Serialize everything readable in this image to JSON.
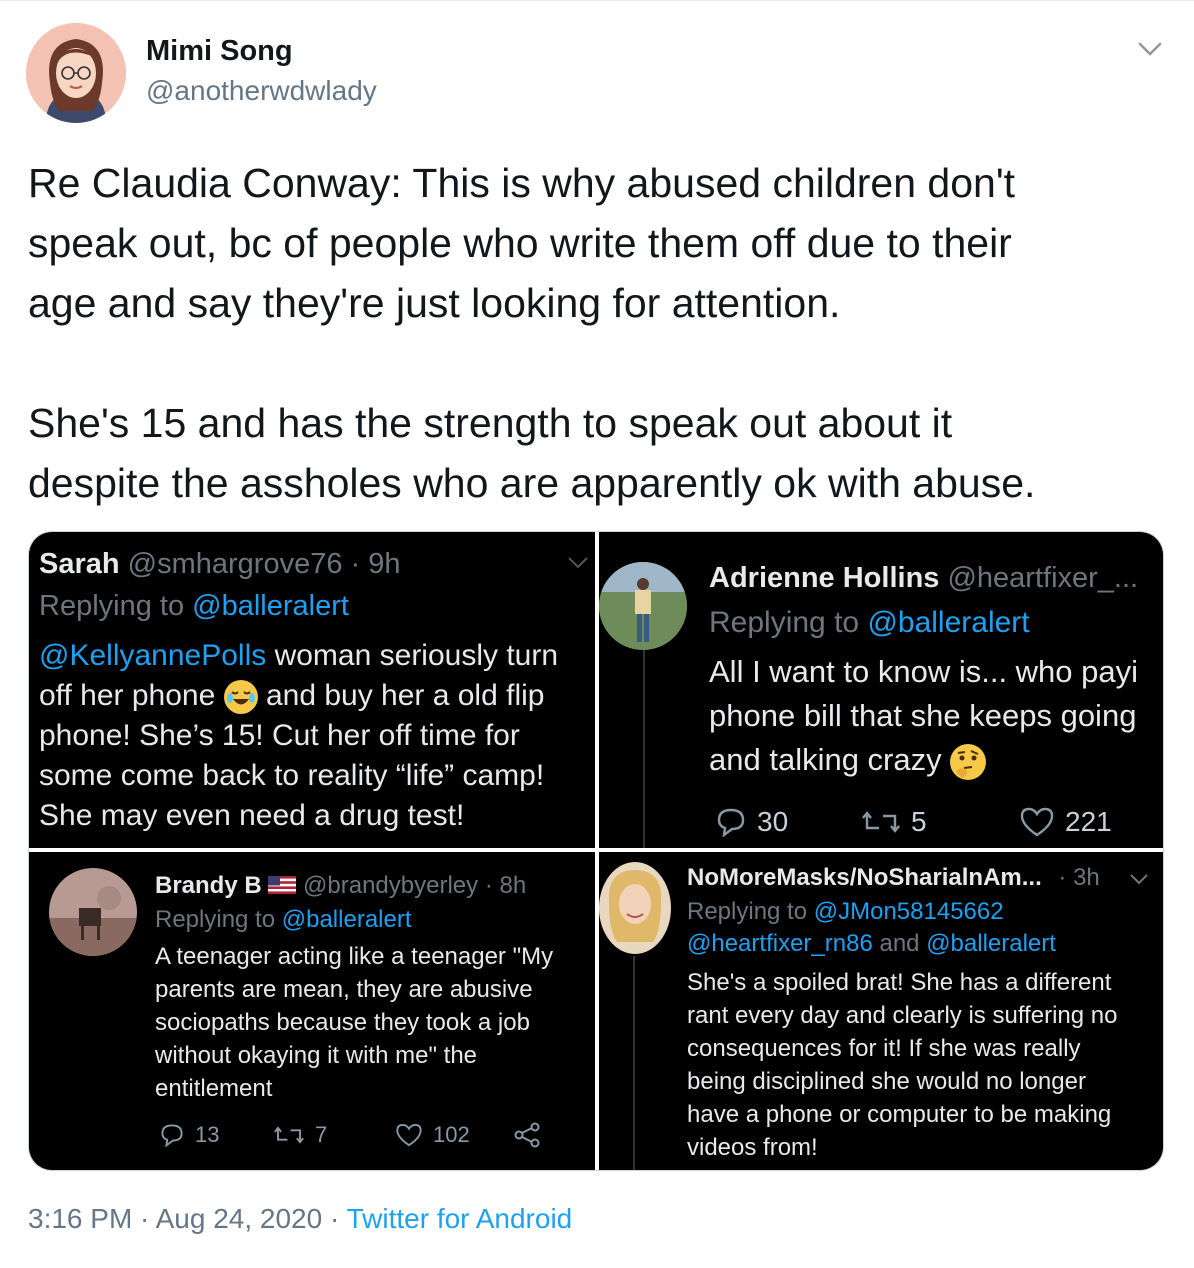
{
  "author": {
    "name": "Mimi Song",
    "handle": "@anotherwdwlady"
  },
  "tweet": {
    "line1": "Re Claudia Conway: This is why abused children don't",
    "line2": "speak out, bc of people who write them off due to their",
    "line3": "age and say they're just looking for attention.",
    "line4": "She's 15 and has the strength to speak out about it",
    "line5": "despite the assholes who are apparently ok with abuse."
  },
  "panels": {
    "p1": {
      "name": "Sarah",
      "handle": "@smhargrove76 · 9h",
      "replying_prefix": "Replying to ",
      "replying_to": "@balleralert",
      "mention": "@KellyannePolls",
      "line1_rest": " woman seriously turn",
      "line2a": "off her phone ",
      "line2b": " and buy her a old flip",
      "line3": "phone! She’s 15! Cut her off time for",
      "line4": "some come back to reality “life” camp!",
      "line5": "She may even need a drug test!"
    },
    "p2": {
      "name": "Adrienne Hollins",
      "handle": "@heartfixer_...",
      "replying_prefix": "Replying to ",
      "replying_to": "@balleralert",
      "line1": "All I want to know is... who payi",
      "line2": "phone bill that she keeps going",
      "line3": "and talking crazy ",
      "replies": "30",
      "retweets": "5",
      "likes": "221"
    },
    "p3": {
      "name": "Brandy B",
      "handle": "@brandybyerley · 8h",
      "replying_prefix": "Replying to ",
      "replying_to": "@balleralert",
      "line1": "A teenager acting like a teenager \"My",
      "line2": "parents are mean, they are abusive",
      "line3": "sociopaths because they took a job",
      "line4": "without okaying it with me\" the",
      "line5": "entitlement",
      "replies": "13",
      "retweets": "7",
      "likes": "102"
    },
    "p4": {
      "name": "NoMoreMasks/NoSharialnAm...",
      "time": "· 3h",
      "replying_prefix": "Replying to ",
      "replying_to": "@JMon58145662",
      "also": "@heartfixer_rn86",
      "and_text": " and ",
      "also2": "@balleralert",
      "line1": "She's a spoiled brat! She has a different",
      "line2": "rant every day and clearly is suffering no",
      "line3": "consequences for it! If she was really",
      "line4": "being disciplined she would no longer",
      "line5": "have a phone or computer to be making",
      "line6": "videos from!"
    }
  },
  "footer": {
    "timestamp": "3:16 PM · Aug 24, 2020 · ",
    "source": "Twitter for Android"
  },
  "colors": {
    "link": "#1da1f2",
    "muted": "#657786",
    "panel_bg": "#000000"
  }
}
